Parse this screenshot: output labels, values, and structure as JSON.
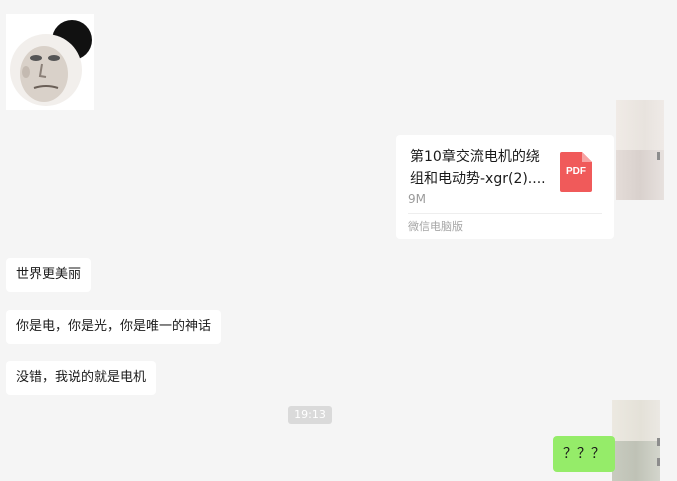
{
  "chat": {
    "file_message": {
      "file_name": "第10章交流电机的绕\n组和电动势-xgr(2)....",
      "file_size": "9M",
      "source": "微信电脑版",
      "file_type_label": "PDF",
      "icon": "pdf-file-icon",
      "icon_color": "#f05a5a"
    },
    "messages": [
      {
        "text": "世界更美丽"
      },
      {
        "text": "你是电，你是光，你是唯一的神话"
      },
      {
        "text": "没错，我说的就是电机"
      }
    ],
    "timestamp": "19:13",
    "sent_message": {
      "text": "？？？",
      "bubble_color": "#95ec69"
    }
  }
}
